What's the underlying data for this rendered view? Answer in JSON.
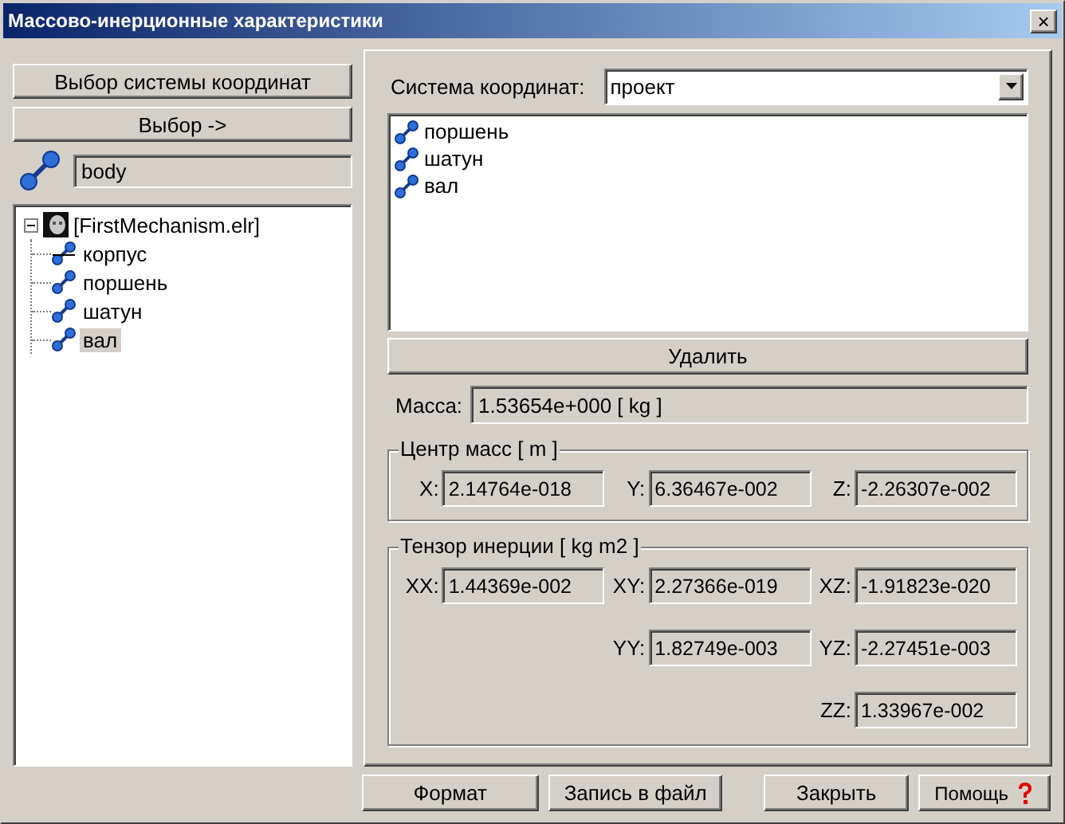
{
  "window": {
    "title": "Массово-инерционные характеристики",
    "close": "×"
  },
  "left": {
    "coord_button": "Выбор системы координат",
    "select_button": "Выбор ->",
    "body_field": "body",
    "tree": {
      "label": "[FirstMechanism.elr]",
      "expanded": true,
      "children": [
        {
          "label": "корпус",
          "kind": "ground",
          "selected": false
        },
        {
          "label": "поршень",
          "kind": "body",
          "selected": false
        },
        {
          "label": "шатун",
          "kind": "body",
          "selected": false
        },
        {
          "label": "вал",
          "kind": "body",
          "selected": true
        }
      ]
    }
  },
  "right": {
    "coord_label": "Система координат:",
    "coord_value": "проект",
    "list": [
      "поршень",
      "шатун",
      "вал"
    ],
    "delete_button": "Удалить",
    "mass_label": "Масса:",
    "mass_value": "1.53654e+000 [ kg ]",
    "center": {
      "title": "Центр масс [ m ]",
      "fields": [
        {
          "label": "X:",
          "value": "2.14764e-018"
        },
        {
          "label": "Y:",
          "value": "6.36467e-002"
        },
        {
          "label": "Z:",
          "value": "-2.26307e-002"
        }
      ]
    },
    "tensor": {
      "title": "Тензор инерции [ kg m2 ]",
      "rows": [
        [
          {
            "label": "XX:",
            "value": "1.44369e-002"
          },
          {
            "label": "XY:",
            "value": "2.27366e-019"
          },
          {
            "label": "XZ:",
            "value": "-1.91823e-020"
          }
        ],
        [
          null,
          {
            "label": "YY:",
            "value": "1.82749e-003"
          },
          {
            "label": "YZ:",
            "value": "-2.27451e-003"
          }
        ],
        [
          null,
          null,
          {
            "label": "ZZ:",
            "value": "1.33967e-002"
          }
        ]
      ]
    }
  },
  "buttons": [
    {
      "label": "Формат",
      "kind": "plain"
    },
    {
      "label": "Запись в файл",
      "kind": "plain"
    },
    {
      "label": "Закрыть",
      "kind": "plain"
    },
    {
      "label": "Помощь",
      "kind": "help"
    }
  ]
}
